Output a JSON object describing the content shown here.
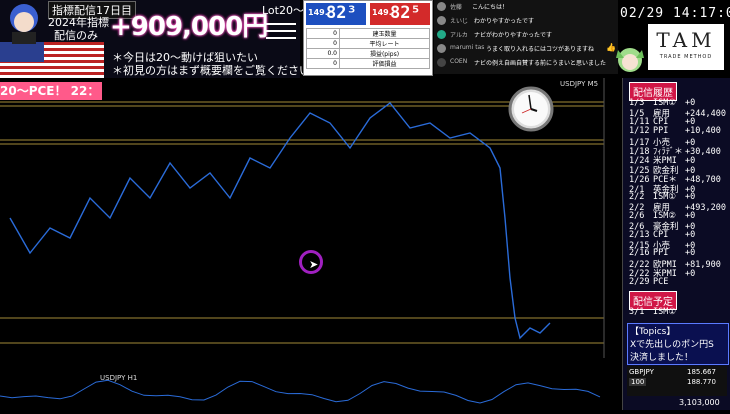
{
  "banner": {
    "day_title": "指標配信17日目",
    "year_label": "2024年指標",
    "only_label": "配信のみ",
    "pnl": "+909,000円",
    "lot_label": "Lot20〜",
    "note1": "＊今日は20〜動けば狙いたい",
    "note2": "＊初見の方はまず概要欄をご覧ください"
  },
  "rates": {
    "bid_prefix": "149.",
    "bid_big": "82³",
    "ask_prefix": "149.",
    "ask_big": "82⁵",
    "rows": [
      {
        "value": "0",
        "label": "建玉数量"
      },
      {
        "value": "0",
        "label": "平均レート"
      },
      {
        "value": "0.0",
        "label": "損益(pips)"
      },
      {
        "value": "0",
        "label": "評価損益"
      }
    ]
  },
  "chat": [
    {
      "name": "佐藤",
      "msg": "こんにちは！"
    },
    {
      "name": "えいじ",
      "msg": "わかりやすかったです"
    },
    {
      "name": "アルカ",
      "msg": "ナビがわかりやすかったです"
    },
    {
      "name": "marumi tas",
      "msg": "うまく取り入れるにはコツがありますね"
    },
    {
      "name": "COEN",
      "msg": "ナビの例え自画自賛する前にうまいと思いました"
    }
  ],
  "datetime": "02/29  14:17:02",
  "tam": {
    "title": "TAM",
    "subtitle": "TRADE METHOD"
  },
  "ticker": "20〜PCE！ 22：",
  "chart": {
    "title": "USDJPY M5",
    "colors": {
      "line": "#2a6bd8",
      "hline": "#d8b84a"
    }
  },
  "sidebar": {
    "history_label": "配信履歴",
    "events": [
      {
        "date": "1/3",
        "name": "ISM①",
        "pnl": "+0"
      },
      {
        "date": "1/5",
        "name": "雇用",
        "pnl": "+244,400"
      },
      {
        "date": "1/11",
        "name": "CPI",
        "pnl": "+0"
      },
      {
        "date": "1/12",
        "name": "PPI",
        "pnl": "+10,400"
      },
      {
        "date": "1/17",
        "name": "小売",
        "pnl": "+0"
      },
      {
        "date": "1/18",
        "name": "ﾌｨﾗﾃﾞ＊",
        "pnl": "+30,400"
      },
      {
        "date": "1/24",
        "name": "米PMI",
        "pnl": "+0"
      },
      {
        "date": "1/25",
        "name": "欧金利",
        "pnl": "+0"
      },
      {
        "date": "1/26",
        "name": "PCE＊",
        "pnl": "+48,700"
      },
      {
        "date": "2/1",
        "name": "英金利",
        "pnl": "+0"
      },
      {
        "date": "2/2",
        "name": "ISM①",
        "pnl": "+0"
      },
      {
        "date": "2/2",
        "name": "雇用",
        "pnl": "+493,200"
      },
      {
        "date": "2/6",
        "name": "ISM②",
        "pnl": "+0"
      },
      {
        "date": "2/6",
        "name": "豪金利",
        "pnl": "+0"
      },
      {
        "date": "2/13",
        "name": "CPI",
        "pnl": "+0"
      },
      {
        "date": "2/15",
        "name": "小売",
        "pnl": "+0"
      },
      {
        "date": "2/16",
        "name": "PPI",
        "pnl": "+0"
      },
      {
        "date": "2/22",
        "name": "欧PMI",
        "pnl": "+81,900"
      },
      {
        "date": "2/22",
        "name": "米PMI",
        "pnl": "+0"
      },
      {
        "date": "2/29",
        "name": "PCE",
        "pnl": ""
      }
    ],
    "schedule_label": "配信予定",
    "schedule": [
      {
        "date": "3/1",
        "name": "ISM①",
        "pnl": ""
      }
    ],
    "topics": {
      "title": "【Topics】",
      "line1": "Xで先出しのポン円S",
      "line2": "決済しました！"
    },
    "pair": {
      "name": "GBPJPY",
      "lot": "100",
      "bid": "185.667",
      "ask": "188.770"
    },
    "balance": "3,103,000"
  },
  "sub_charts": {
    "title": "USDJPY H1"
  }
}
